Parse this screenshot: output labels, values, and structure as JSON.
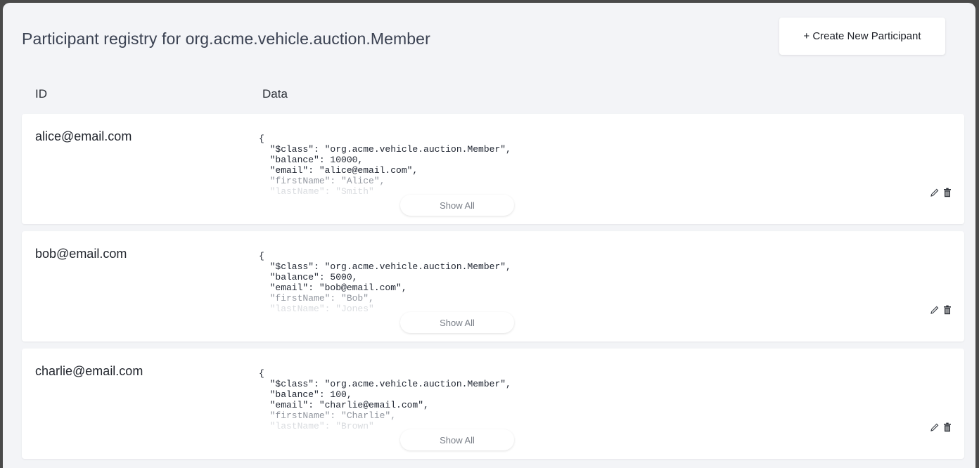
{
  "header": {
    "title": "Participant registry for org.acme.vehicle.auction.Member",
    "create_button_label": "+ Create New Participant"
  },
  "columns": {
    "id": "ID",
    "data": "Data"
  },
  "rows": [
    {
      "id": "alice@email.com",
      "json_lines": [
        "{",
        "  \"$class\": \"org.acme.vehicle.auction.Member\",",
        "  \"balance\": 10000,",
        "  \"email\": \"alice@email.com\",",
        "  \"firstName\": \"Alice\",",
        "  \"lastName\": \"Smith\""
      ],
      "show_all_label": "Show All"
    },
    {
      "id": "bob@email.com",
      "json_lines": [
        "{",
        "  \"$class\": \"org.acme.vehicle.auction.Member\",",
        "  \"balance\": 5000,",
        "  \"email\": \"bob@email.com\",",
        "  \"firstName\": \"Bob\",",
        "  \"lastName\": \"Jones\""
      ],
      "show_all_label": "Show All"
    },
    {
      "id": "charlie@email.com",
      "json_lines": [
        "{",
        "  \"$class\": \"org.acme.vehicle.auction.Member\",",
        "  \"balance\": 100,",
        "  \"email\": \"charlie@email.com\",",
        "  \"firstName\": \"Charlie\",",
        "  \"lastName\": \"Brown\""
      ],
      "show_all_label": "Show All"
    }
  ],
  "icons": {
    "edit": "pencil-icon",
    "delete": "trash-icon"
  },
  "colors": {
    "background": "#f3f4f7",
    "card": "#ffffff",
    "title_text": "#3b4252",
    "muted_text": "#7b8089"
  }
}
